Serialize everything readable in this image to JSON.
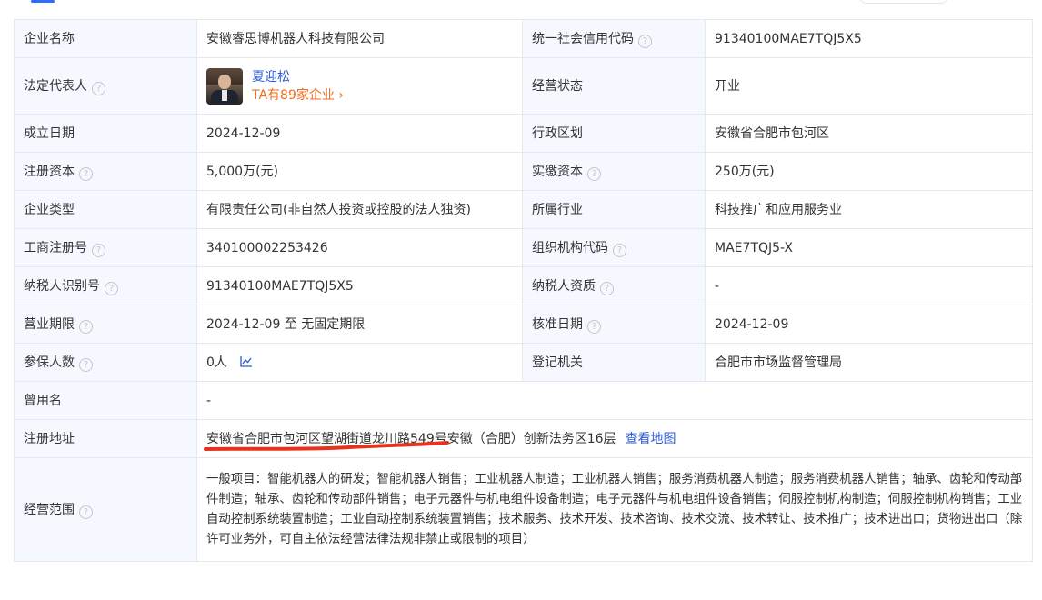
{
  "rows": [
    {
      "l1": "企业名称",
      "v1": "安徽睿思博机器人科技有限公司",
      "l2": "统一社会信用代码",
      "v2": "91340100MAE7TQJ5X5"
    },
    {
      "l1": "法定代表人",
      "rep_name": "夏迎松",
      "rep_link": "TA有89家企业",
      "l2": "经营状态",
      "v2": "开业"
    },
    {
      "l1": "成立日期",
      "v1": "2024-12-09",
      "l2": "行政区划",
      "v2": "安徽省合肥市包河区"
    },
    {
      "l1": "注册资本",
      "v1": "5,000万(元)",
      "l2": "实缴资本",
      "v2": "250万(元)"
    },
    {
      "l1": "企业类型",
      "v1": "有限责任公司(非自然人投资或控股的法人独资)",
      "l2": "所属行业",
      "v2": "科技推广和应用服务业"
    },
    {
      "l1": "工商注册号",
      "v1": "340100002253426",
      "l2": "组织机构代码",
      "v2": "MAE7TQJ5-X"
    },
    {
      "l1": "纳税人识别号",
      "v1": "91340100MAE7TQJ5X5",
      "l2": "纳税人资质",
      "v2": "-"
    },
    {
      "l1": "营业期限",
      "v1": "2024-12-09 至 无固定期限",
      "l2": "核准日期",
      "v2": "2024-12-09"
    },
    {
      "l1": "参保人数",
      "v1": "0人",
      "l2": "登记机关",
      "v2": "合肥市市场监督管理局"
    },
    {
      "l1": "曾用名",
      "v1": "-"
    },
    {
      "l1": "注册地址",
      "v1": "安徽省合肥市包河区望湖街道龙川路549号安徽（合肥）创新法务区16层",
      "map_link": "查看地图"
    },
    {
      "l1": "经营范围",
      "v1": "一般项目：智能机器人的研发；智能机器人销售；工业机器人制造；工业机器人销售；服务消费机器人制造；服务消费机器人销售；轴承、齿轮和传动部件制造；轴承、齿轮和传动部件销售；电子元器件与机电组件设备制造；电子元器件与机电组件设备销售；伺服控制机构制造；伺服控制机构销售；工业自动控制系统装置制造；工业自动控制系统装置销售；技术服务、技术开发、技术咨询、技术交流、技术转让、技术推广；技术进出口；货物进出口（除许可业务外，可自主依法经营法律法规非禁止或限制的项目）"
    }
  ],
  "help_glyph": "?",
  "chevron": "›",
  "colors": {
    "label_bg": "#f5f8ff",
    "border": "#e4e8ef",
    "link": "#2a5ad8",
    "orange": "#f06b1b",
    "annotation": "#e8321e"
  }
}
